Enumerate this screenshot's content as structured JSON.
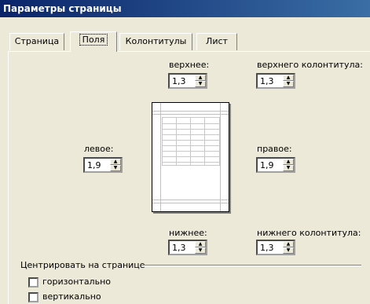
{
  "window": {
    "title": "Параметры страницы"
  },
  "tabs": [
    {
      "label": "Страница"
    },
    {
      "label": "Поля"
    },
    {
      "label": "Колонтитулы"
    },
    {
      "label": "Лист"
    }
  ],
  "margins": {
    "top": {
      "label": "верхнее:",
      "value": "1,3"
    },
    "header": {
      "label": "верхнего колонтитула:",
      "value": "1,3"
    },
    "left": {
      "label": "левое:",
      "value": "1,9"
    },
    "right": {
      "label": "правое:",
      "value": "1,9"
    },
    "bottom": {
      "label": "нижнее:",
      "value": "1,3"
    },
    "footer": {
      "label": "нижнего колонтитула:",
      "value": "1,3"
    }
  },
  "center": {
    "title": "Центрировать на странице",
    "horizontal": "горизонтально",
    "vertical": "вертикально"
  }
}
